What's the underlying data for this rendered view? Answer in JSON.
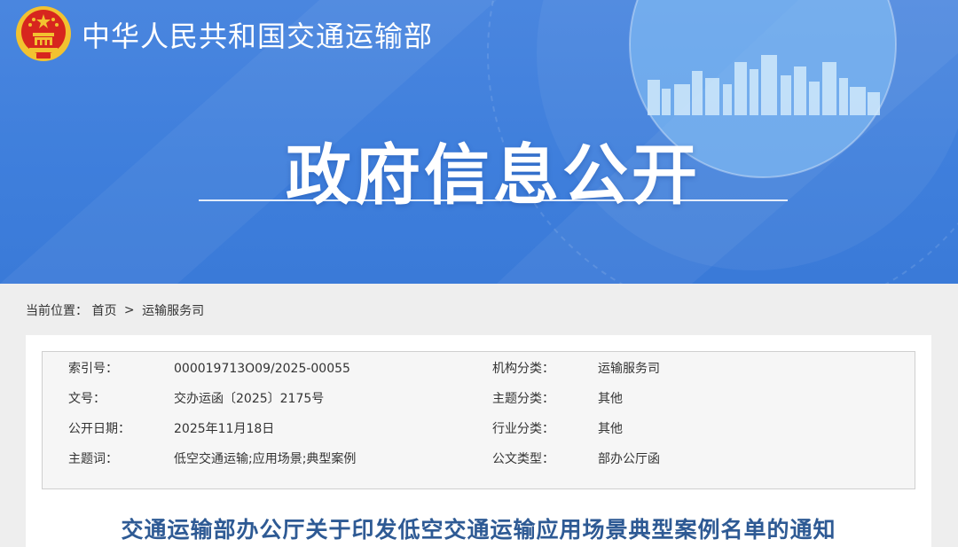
{
  "header": {
    "ministry_name": "中华人民共和国交通运输部",
    "banner_title": "政府信息公开"
  },
  "breadcrumb": {
    "label": "当前位置：",
    "items": [
      "首页",
      "运输服务司"
    ],
    "separator": ">"
  },
  "meta": {
    "rows": [
      {
        "k1": "索引号：",
        "v1": "000019713O09/2025-00055",
        "k2": "机构分类：",
        "v2": "运输服务司"
      },
      {
        "k1": "文号：",
        "v1": "交办运函〔2025〕2175号",
        "k2": "主题分类：",
        "v2": "其他"
      },
      {
        "k1": "公开日期：",
        "v1": "2025年11月18日",
        "k2": "行业分类：",
        "v2": "其他"
      },
      {
        "k1": "主题词：",
        "v1": "低空交通运输;应用场景;典型案例",
        "k2": "公文类型：",
        "v2": "部办公厅函"
      }
    ]
  },
  "document": {
    "title": "交通运输部办公厅关于印发低空交通运输应用场景典型案例名单的通知"
  },
  "colors": {
    "banner_blue": "#3f7fdc",
    "title_blue": "#2e5a94",
    "emblem_red": "#d7261e",
    "emblem_gold": "#f2c230"
  },
  "icons": {
    "emblem": "national-emblem-icon",
    "skyline": "city-skyline-decoration"
  }
}
